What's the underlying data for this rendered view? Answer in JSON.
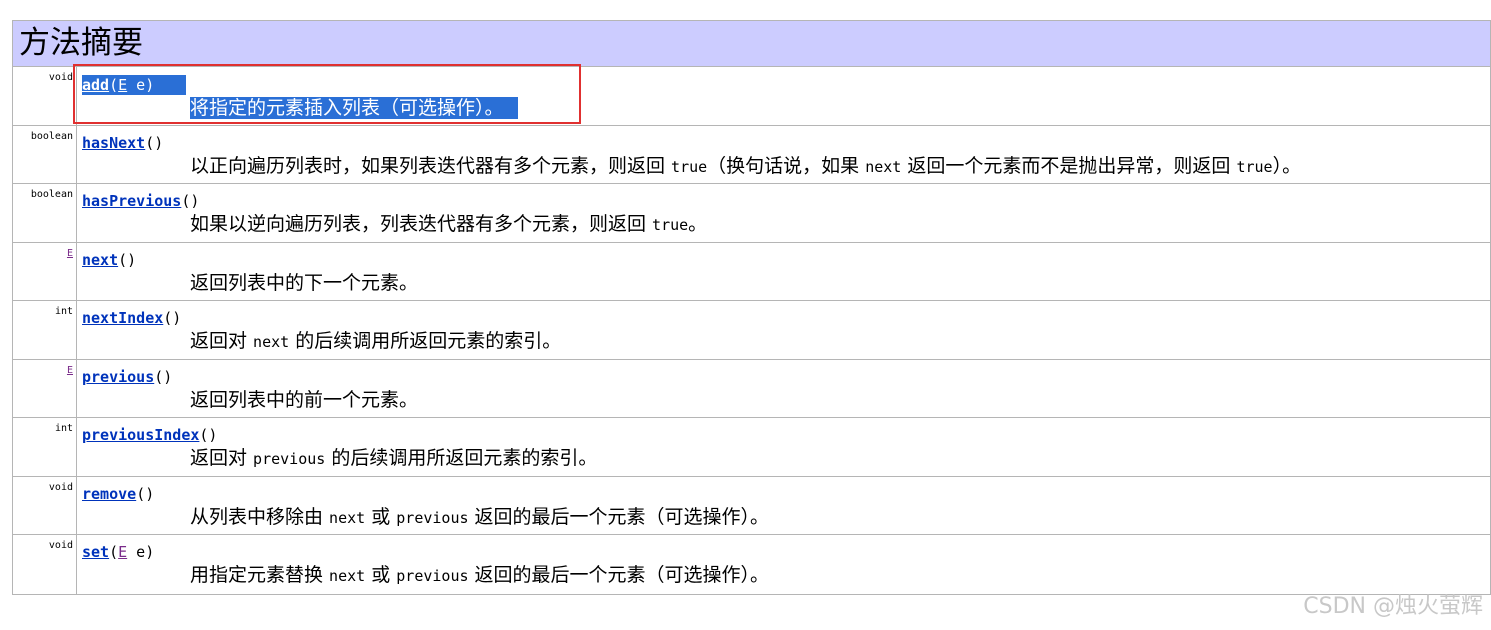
{
  "header": {
    "title": "方法摘要"
  },
  "methods": [
    {
      "type": "void",
      "name": "add",
      "params_open": "(",
      "param_type": "E",
      "param_rest": " e)",
      "description": "将指定的元素插入列表（可选操作）。"
    },
    {
      "type": "boolean",
      "name": "hasNext",
      "params": "()",
      "desc_parts": [
        "以正向遍历列表时，如果列表迭代器有多个元素，则返回 ",
        "true",
        "（换句话说，如果 ",
        "next",
        " 返回一个元素而不是抛出异常，则返回 ",
        "true",
        "）。"
      ]
    },
    {
      "type": "boolean",
      "name": "hasPrevious",
      "params": "()",
      "desc_parts": [
        "如果以逆向遍历列表，列表迭代器有多个元素，则返回 ",
        "true",
        "。"
      ]
    },
    {
      "type": "E",
      "name": "next",
      "params": "()",
      "description": "返回列表中的下一个元素。"
    },
    {
      "type": "int",
      "name": "nextIndex",
      "params": "()",
      "desc_parts": [
        "返回对 ",
        "next",
        " 的后续调用所返回元素的索引。"
      ]
    },
    {
      "type": "E",
      "name": "previous",
      "params": "()",
      "description": "返回列表中的前一个元素。"
    },
    {
      "type": "int",
      "name": "previousIndex",
      "params": "()",
      "desc_parts": [
        "返回对 ",
        "previous",
        " 的后续调用所返回元素的索引。"
      ]
    },
    {
      "type": "void",
      "name": "remove",
      "params": "()",
      "desc_parts": [
        "从列表中移除由 ",
        "next",
        " 或 ",
        "previous",
        " 返回的最后一个元素（可选操作）。"
      ]
    },
    {
      "type": "void",
      "name": "set",
      "params_open": "(",
      "param_type": "E",
      "param_rest": " e)",
      "description": "用指定元素替换 next 或 previous 返回的最后一个元素（可选操作）。",
      "desc_parts": [
        "用指定元素替换 ",
        "next",
        " 或 ",
        "previous",
        " 返回的最后一个元素（可选操作）。"
      ]
    }
  ],
  "watermark": "CSDN @烛火萤辉",
  "colors": {
    "header_bg": "#ccccff",
    "link": "#0033bb",
    "selection": "#2a6fd6",
    "highlight_box": "#e03030"
  }
}
